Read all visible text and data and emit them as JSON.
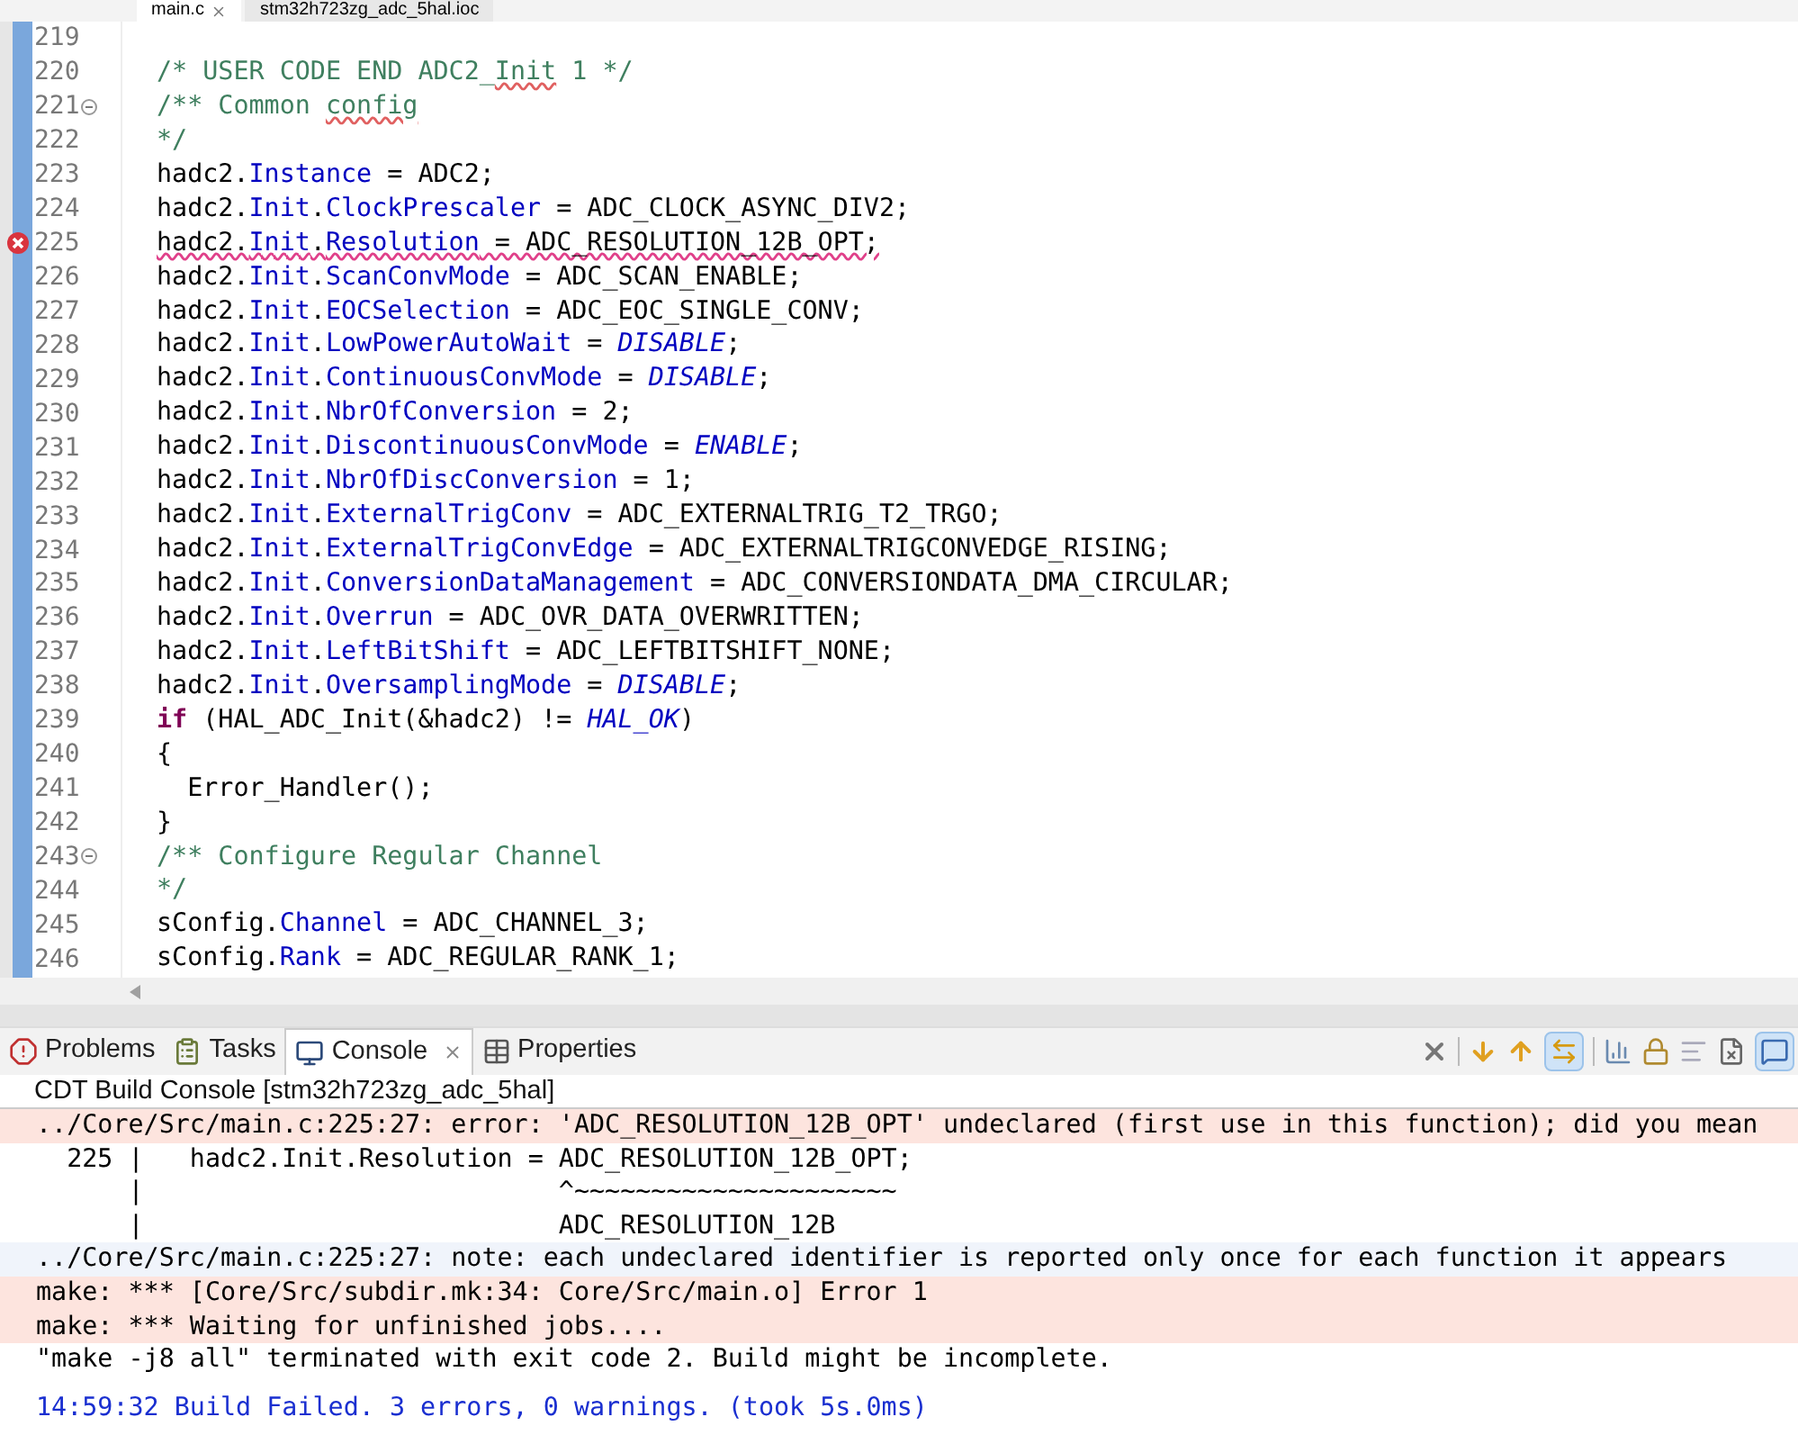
{
  "editor_tabs": [
    {
      "label": "main.c",
      "selected": true
    },
    {
      "label": "stm32h723zg_adc_5hal.ioc",
      "selected": false
    }
  ],
  "code_lines": [
    {
      "number": "219",
      "error": false,
      "foldable": false
    },
    {
      "number": "220",
      "error": false,
      "foldable": false,
      "tokens": [
        {
          "kind": "comment",
          "text": "/* USER CODE END ADC2_"
        },
        {
          "kind": "comment-spell",
          "text": "Init"
        },
        {
          "kind": "comment",
          "text": " 1 */"
        }
      ]
    },
    {
      "number": "221",
      "error": false,
      "foldable": true,
      "tokens": [
        {
          "kind": "comment",
          "text": "/** Common "
        },
        {
          "kind": "comment-spell",
          "text": "config"
        }
      ]
    },
    {
      "number": "222",
      "error": false,
      "foldable": false,
      "tokens": [
        {
          "kind": "comment",
          "text": "*/"
        }
      ]
    },
    {
      "number": "223",
      "error": false,
      "foldable": false,
      "tokens": [
        {
          "kind": "plain",
          "text": "hadc2."
        },
        {
          "kind": "field",
          "text": "Instance"
        },
        {
          "kind": "plain",
          "text": " = ADC2;"
        }
      ]
    },
    {
      "number": "224",
      "error": false,
      "foldable": false,
      "tokens": [
        {
          "kind": "plain",
          "text": "hadc2."
        },
        {
          "kind": "field",
          "text": "Init"
        },
        {
          "kind": "plain",
          "text": "."
        },
        {
          "kind": "field",
          "text": "ClockPrescaler"
        },
        {
          "kind": "plain",
          "text": " = ADC_CLOCK_ASYNC_DIV2;"
        }
      ]
    },
    {
      "number": "225",
      "error": true,
      "foldable": false,
      "tokens": [
        {
          "kind": "plain",
          "text": "hadc2."
        },
        {
          "kind": "field",
          "text": "Init"
        },
        {
          "kind": "plain",
          "text": "."
        },
        {
          "kind": "field",
          "text": "Resolution"
        },
        {
          "kind": "plain",
          "text": " = ADC_RESOLUTION_12B_OPT;"
        }
      ]
    },
    {
      "number": "226",
      "error": false,
      "foldable": false,
      "tokens": [
        {
          "kind": "plain",
          "text": "hadc2."
        },
        {
          "kind": "field",
          "text": "Init"
        },
        {
          "kind": "plain",
          "text": "."
        },
        {
          "kind": "field",
          "text": "ScanConvMode"
        },
        {
          "kind": "plain",
          "text": " = ADC_SCAN_ENABLE;"
        }
      ]
    },
    {
      "number": "227",
      "error": false,
      "foldable": false,
      "tokens": [
        {
          "kind": "plain",
          "text": "hadc2."
        },
        {
          "kind": "field",
          "text": "Init"
        },
        {
          "kind": "plain",
          "text": "."
        },
        {
          "kind": "field",
          "text": "EOCSelection"
        },
        {
          "kind": "plain",
          "text": " = ADC_EOC_SINGLE_CONV;"
        }
      ]
    },
    {
      "number": "228",
      "error": false,
      "foldable": false,
      "tokens": [
        {
          "kind": "plain",
          "text": "hadc2."
        },
        {
          "kind": "field",
          "text": "Init"
        },
        {
          "kind": "plain",
          "text": "."
        },
        {
          "kind": "field",
          "text": "LowPowerAutoWait"
        },
        {
          "kind": "plain",
          "text": " = "
        },
        {
          "kind": "enum",
          "text": "DISABLE"
        },
        {
          "kind": "plain",
          "text": ";"
        }
      ]
    },
    {
      "number": "229",
      "error": false,
      "foldable": false,
      "tokens": [
        {
          "kind": "plain",
          "text": "hadc2."
        },
        {
          "kind": "field",
          "text": "Init"
        },
        {
          "kind": "plain",
          "text": "."
        },
        {
          "kind": "field",
          "text": "ContinuousConvMode"
        },
        {
          "kind": "plain",
          "text": " = "
        },
        {
          "kind": "enum",
          "text": "DISABLE"
        },
        {
          "kind": "plain",
          "text": ";"
        }
      ]
    },
    {
      "number": "230",
      "error": false,
      "foldable": false,
      "tokens": [
        {
          "kind": "plain",
          "text": "hadc2."
        },
        {
          "kind": "field",
          "text": "Init"
        },
        {
          "kind": "plain",
          "text": "."
        },
        {
          "kind": "field",
          "text": "NbrOfConversion"
        },
        {
          "kind": "plain",
          "text": " = 2;"
        }
      ]
    },
    {
      "number": "231",
      "error": false,
      "foldable": false,
      "tokens": [
        {
          "kind": "plain",
          "text": "hadc2."
        },
        {
          "kind": "field",
          "text": "Init"
        },
        {
          "kind": "plain",
          "text": "."
        },
        {
          "kind": "field",
          "text": "DiscontinuousConvMode"
        },
        {
          "kind": "plain",
          "text": " = "
        },
        {
          "kind": "enum",
          "text": "ENABLE"
        },
        {
          "kind": "plain",
          "text": ";"
        }
      ]
    },
    {
      "number": "232",
      "error": false,
      "foldable": false,
      "tokens": [
        {
          "kind": "plain",
          "text": "hadc2."
        },
        {
          "kind": "field",
          "text": "Init"
        },
        {
          "kind": "plain",
          "text": "."
        },
        {
          "kind": "field",
          "text": "NbrOfDiscConversion"
        },
        {
          "kind": "plain",
          "text": " = 1;"
        }
      ]
    },
    {
      "number": "233",
      "error": false,
      "foldable": false,
      "tokens": [
        {
          "kind": "plain",
          "text": "hadc2."
        },
        {
          "kind": "field",
          "text": "Init"
        },
        {
          "kind": "plain",
          "text": "."
        },
        {
          "kind": "field",
          "text": "ExternalTrigConv"
        },
        {
          "kind": "plain",
          "text": " = ADC_EXTERNALTRIG_T2_TRGO;"
        }
      ]
    },
    {
      "number": "234",
      "error": false,
      "foldable": false,
      "tokens": [
        {
          "kind": "plain",
          "text": "hadc2."
        },
        {
          "kind": "field",
          "text": "Init"
        },
        {
          "kind": "plain",
          "text": "."
        },
        {
          "kind": "field",
          "text": "ExternalTrigConvEdge"
        },
        {
          "kind": "plain",
          "text": " = ADC_EXTERNALTRIGCONVEDGE_RISING;"
        }
      ]
    },
    {
      "number": "235",
      "error": false,
      "foldable": false,
      "tokens": [
        {
          "kind": "plain",
          "text": "hadc2."
        },
        {
          "kind": "field",
          "text": "Init"
        },
        {
          "kind": "plain",
          "text": "."
        },
        {
          "kind": "field",
          "text": "ConversionDataManagement"
        },
        {
          "kind": "plain",
          "text": " = ADC_CONVERSIONDATA_DMA_CIRCULAR;"
        }
      ]
    },
    {
      "number": "236",
      "error": false,
      "foldable": false,
      "tokens": [
        {
          "kind": "plain",
          "text": "hadc2."
        },
        {
          "kind": "field",
          "text": "Init"
        },
        {
          "kind": "plain",
          "text": "."
        },
        {
          "kind": "field",
          "text": "Overrun"
        },
        {
          "kind": "plain",
          "text": " = ADC_OVR_DATA_OVERWRITTEN;"
        }
      ]
    },
    {
      "number": "237",
      "error": false,
      "foldable": false,
      "tokens": [
        {
          "kind": "plain",
          "text": "hadc2."
        },
        {
          "kind": "field",
          "text": "Init"
        },
        {
          "kind": "plain",
          "text": "."
        },
        {
          "kind": "field",
          "text": "LeftBitShift"
        },
        {
          "kind": "plain",
          "text": " = ADC_LEFTBITSHIFT_NONE;"
        }
      ]
    },
    {
      "number": "238",
      "error": false,
      "foldable": false,
      "tokens": [
        {
          "kind": "plain",
          "text": "hadc2."
        },
        {
          "kind": "field",
          "text": "Init"
        },
        {
          "kind": "plain",
          "text": "."
        },
        {
          "kind": "field",
          "text": "OversamplingMode"
        },
        {
          "kind": "plain",
          "text": " = "
        },
        {
          "kind": "enum",
          "text": "DISABLE"
        },
        {
          "kind": "plain",
          "text": ";"
        }
      ]
    },
    {
      "number": "239",
      "error": false,
      "foldable": false,
      "tokens": [
        {
          "kind": "keyword",
          "text": "if"
        },
        {
          "kind": "plain",
          "text": " (HAL_ADC_Init(&hadc2) != "
        },
        {
          "kind": "enum",
          "text": "HAL_OK"
        },
        {
          "kind": "plain",
          "text": ")"
        }
      ]
    },
    {
      "number": "240",
      "error": false,
      "foldable": false,
      "tokens": [
        {
          "kind": "plain",
          "text": "{"
        }
      ]
    },
    {
      "number": "241",
      "error": false,
      "foldable": false,
      "tokens": [
        {
          "kind": "plain",
          "text": "  Error_Handler();"
        }
      ]
    },
    {
      "number": "242",
      "error": false,
      "foldable": false,
      "tokens": [
        {
          "kind": "plain",
          "text": "}"
        }
      ]
    },
    {
      "number": "243",
      "error": false,
      "foldable": true,
      "tokens": [
        {
          "kind": "comment",
          "text": "/** Configure Regular Channel"
        }
      ]
    },
    {
      "number": "244",
      "error": false,
      "foldable": false,
      "tokens": [
        {
          "kind": "comment",
          "text": "*/"
        }
      ]
    },
    {
      "number": "245",
      "error": false,
      "foldable": false,
      "tokens": [
        {
          "kind": "plain",
          "text": "sConfig."
        },
        {
          "kind": "field",
          "text": "Channel"
        },
        {
          "kind": "plain",
          "text": " = ADC_CHANNEL_3;"
        }
      ]
    },
    {
      "number": "246",
      "error": false,
      "foldable": false,
      "tokens": [
        {
          "kind": "plain",
          "text": "sConfig."
        },
        {
          "kind": "field",
          "text": "Rank"
        },
        {
          "kind": "plain",
          "text": " = ADC_REGULAR_RANK_1;"
        }
      ]
    }
  ],
  "view_tabs": [
    {
      "label": "Problems",
      "selected": false,
      "kind": "problems"
    },
    {
      "label": "Tasks",
      "selected": false,
      "kind": "tasks"
    },
    {
      "label": "Console",
      "selected": true,
      "kind": "console"
    },
    {
      "label": "Properties",
      "selected": false,
      "kind": "properties"
    }
  ],
  "console": {
    "title": "CDT Build Console [stm32h723zg_adc_5hal]",
    "lines": [
      {
        "kind": "error",
        "text": "../Core/Src/main.c:225:27: error: 'ADC_RESOLUTION_12B_OPT' undeclared (first use in this function); did you mean"
      },
      {
        "kind": "normal",
        "text": "  225 |   hadc2.Init.Resolution = ADC_RESOLUTION_12B_OPT;"
      },
      {
        "kind": "normal",
        "text": "      |                           ^~~~~~~~~~~~~~~~~~~~~~"
      },
      {
        "kind": "normal",
        "text": "      |                           ADC_RESOLUTION_12B"
      },
      {
        "kind": "info",
        "text": "../Core/Src/main.c:225:27: note: each undeclared identifier is reported only once for each function it appears"
      },
      {
        "kind": "error",
        "text": "make: *** [Core/Src/subdir.mk:34: Core/Src/main.o] Error 1"
      },
      {
        "kind": "error",
        "text": "make: *** Waiting for unfinished jobs...."
      },
      {
        "kind": "normal",
        "text": "\"make -j8 all\" terminated with exit code 2. Build might be incomplete."
      },
      {
        "kind": "status",
        "text": "14:59:32 Build Failed. 3 errors, 0 warnings. (took 5s.0ms)"
      }
    ]
  }
}
